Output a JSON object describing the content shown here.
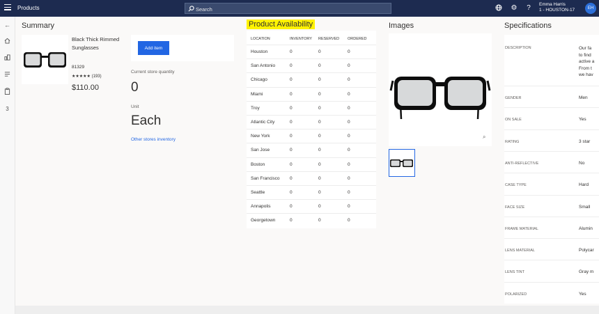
{
  "app": {
    "title": "Products"
  },
  "search": {
    "placeholder": "Search"
  },
  "user": {
    "name": "Emma Harris",
    "store": "1 - HOUSTON-17",
    "initials": "EH"
  },
  "rail": {
    "badge": "3"
  },
  "summary": {
    "title": "Summary",
    "product_name": "Black Thick Rimmed Sunglasses",
    "product_id": "81329",
    "stars": "★★★★★",
    "rating_value": 5,
    "review_count": "(193)",
    "price": "$110.00",
    "add_label": "Add item",
    "qty_label": "Current store quantity",
    "qty_value": "0",
    "unit_label": "Unit",
    "unit_value": "Each",
    "other_link": "Other stores inventory"
  },
  "availability": {
    "title": "Product Availability",
    "headers": [
      "LOCATION",
      "INVENTORY",
      "RESERVED",
      "ORDERED"
    ],
    "rows": [
      [
        "Houston",
        "0",
        "0",
        "0"
      ],
      [
        "San Antonio",
        "0",
        "0",
        "0"
      ],
      [
        "Chicago",
        "0",
        "0",
        "0"
      ],
      [
        "Miami",
        "0",
        "0",
        "0"
      ],
      [
        "Troy",
        "0",
        "0",
        "0"
      ],
      [
        "Atlantic City",
        "0",
        "0",
        "0"
      ],
      [
        "New York",
        "0",
        "0",
        "0"
      ],
      [
        "San Jose",
        "0",
        "0",
        "0"
      ],
      [
        "Boston",
        "0",
        "0",
        "0"
      ],
      [
        "San Francisco",
        "0",
        "0",
        "0"
      ],
      [
        "Seattle",
        "0",
        "0",
        "0"
      ],
      [
        "Annapolis",
        "0",
        "0",
        "0"
      ],
      [
        "Georgetown",
        "0",
        "0",
        "0"
      ]
    ]
  },
  "images": {
    "title": "Images"
  },
  "specs": {
    "title": "Specifications",
    "description_label": "DESCRIPTION",
    "description_lines": [
      "Our fa",
      "to find",
      "active a",
      "From t",
      "we hav"
    ],
    "rows": [
      [
        "GENDER",
        "Men"
      ],
      [
        "ON SALE",
        "Yes"
      ],
      [
        "RATING",
        "3 star"
      ],
      [
        "ANTI-REFLECTIVE",
        "No"
      ],
      [
        "CASE TYPE",
        "Hard"
      ],
      [
        "FACE SIZE",
        "Small"
      ],
      [
        "FRAME MATERIAL",
        "Alumin"
      ],
      [
        "LENS MATERIAL",
        "Polycar"
      ],
      [
        "LENS TINT",
        "Gray m"
      ],
      [
        "POLARIZED",
        "Yes"
      ]
    ]
  },
  "colors": {
    "topbar": "#1d2b50",
    "accent": "#2266e3",
    "highlight": "#fff200"
  },
  "icons": [
    "hamburger-icon",
    "search-icon",
    "globe-icon",
    "gear-icon",
    "help-icon",
    "back-icon",
    "home-icon",
    "org-icon",
    "list-icon",
    "clipboard-icon",
    "zoom-icon"
  ]
}
